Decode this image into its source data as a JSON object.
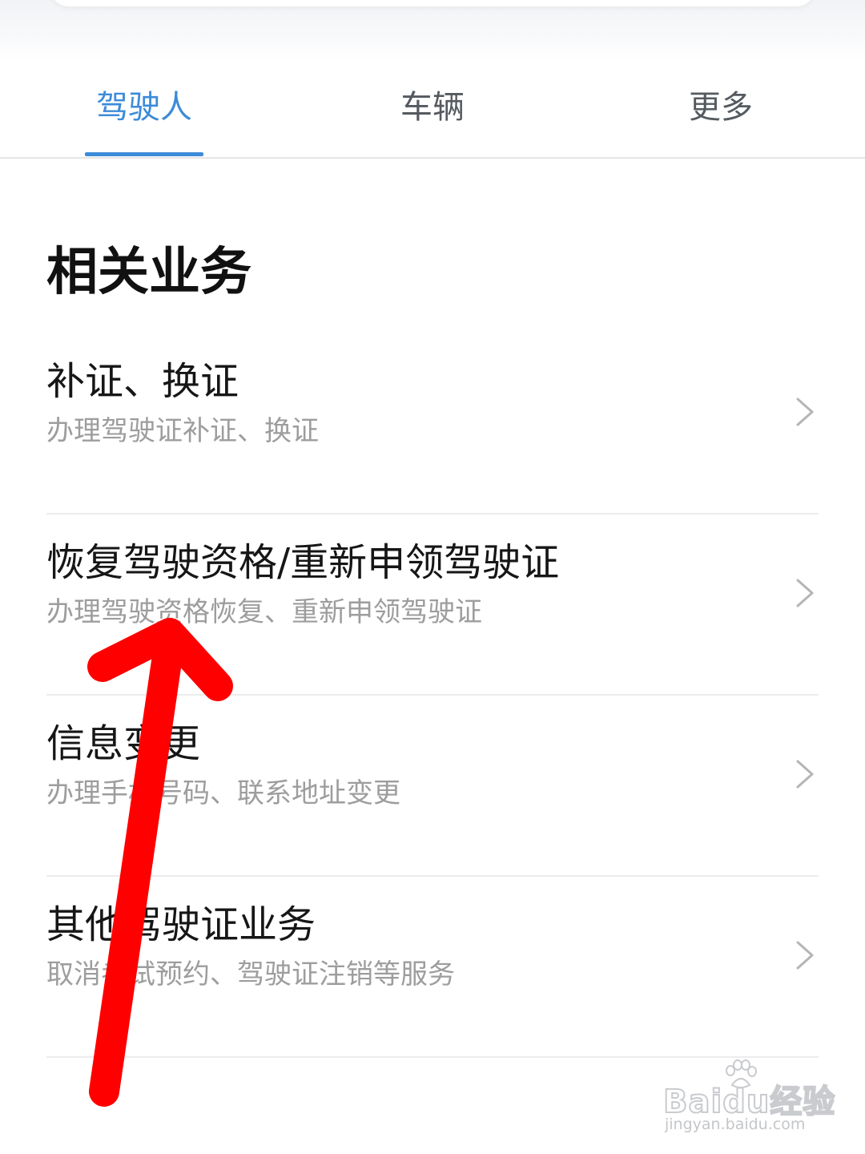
{
  "tabs": [
    {
      "label": "驾驶人",
      "active": true
    },
    {
      "label": "车辆",
      "active": false
    },
    {
      "label": "更多",
      "active": false
    }
  ],
  "section_title": "相关业务",
  "items": [
    {
      "title": "补证、换证",
      "desc": "办理驾驶证补证、换证"
    },
    {
      "title": "恢复驾驶资格/重新申领驾驶证",
      "desc": "办理驾驶资格恢复、重新申领驾驶证"
    },
    {
      "title": "信息变更",
      "desc": "办理手机号码、联系地址变更"
    },
    {
      "title": "其他驾驶证业务",
      "desc": "取消考试预约、驾驶证注销等服务"
    }
  ],
  "watermark": {
    "logo_text": "Baidu经验",
    "url": "jingyan.baidu.com"
  },
  "colors": {
    "accent": "#3d8bd8",
    "annotation_arrow": "#ff0000",
    "secondary_text": "#9d9d9d"
  },
  "icons": {
    "item_chevron": "chevron-right-icon",
    "annotation": "red-arrow-annotation"
  }
}
